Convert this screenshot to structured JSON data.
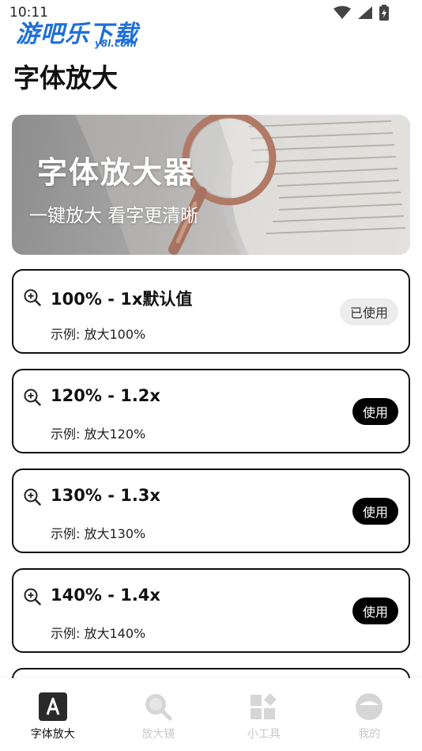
{
  "status_bar": {
    "time": "10:11"
  },
  "watermark": {
    "main": "游吧乐下载",
    "sub": "y8l.com"
  },
  "page": {
    "title": "字体放大"
  },
  "banner": {
    "title": "字体放大器",
    "subtitle": "一键放大 看字更清晰"
  },
  "options": [
    {
      "title": "100% - 1x默认值",
      "example": "示例: 放大100%",
      "button": "已使用",
      "state": "used"
    },
    {
      "title": "120% - 1.2x",
      "example": "示例: 放大120%",
      "button": "使用",
      "state": "available"
    },
    {
      "title": "130% - 1.3x",
      "example": "示例: 放大130%",
      "button": "使用",
      "state": "available"
    },
    {
      "title": "140% - 1.4x",
      "example": "示例: 放大140%",
      "button": "使用",
      "state": "available"
    }
  ],
  "nav": {
    "items": [
      {
        "label": "字体放大",
        "icon": "font-a-icon",
        "active": true
      },
      {
        "label": "放大镜",
        "icon": "magnifier-icon",
        "active": false
      },
      {
        "label": "小工具",
        "icon": "tools-grid-icon",
        "active": false
      },
      {
        "label": "我的",
        "icon": "profile-face-icon",
        "active": false
      }
    ]
  },
  "colors": {
    "accent": "#000000",
    "card_border": "#111111",
    "used_button_bg": "#ececec",
    "nav_inactive": "#c8c8c8",
    "watermark_blue": "#1e6fd9"
  }
}
